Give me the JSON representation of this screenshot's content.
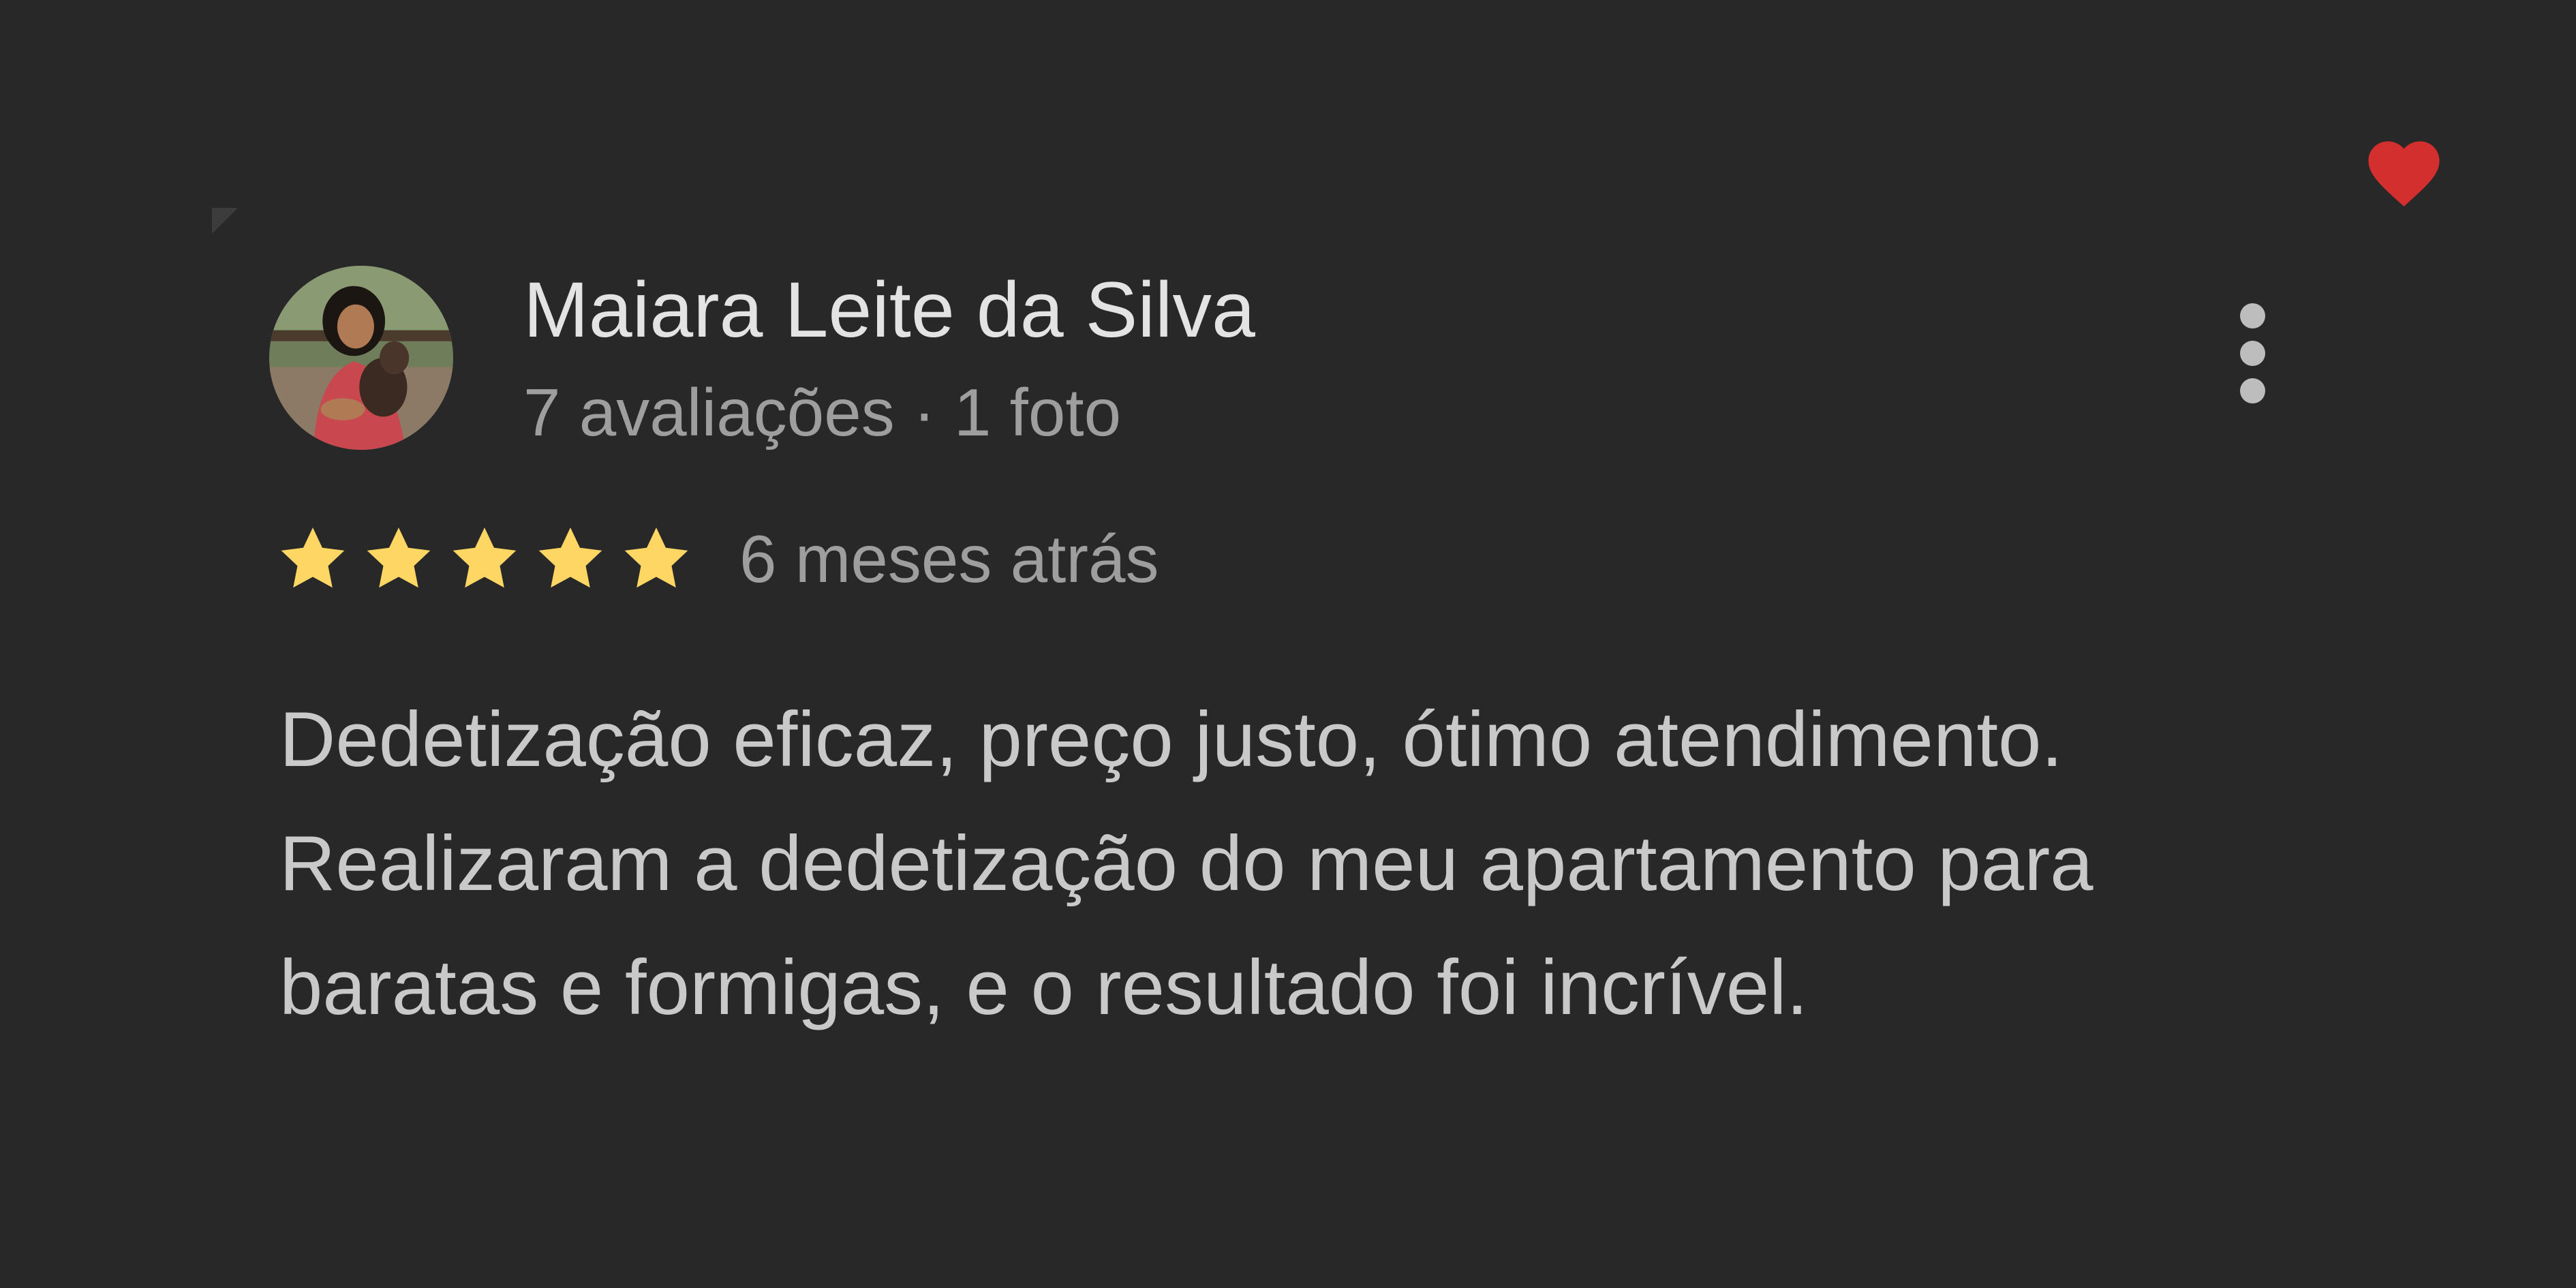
{
  "colors": {
    "background": "#282828",
    "heart": "#d32f2f",
    "star": "#fdd663",
    "name_text": "#e3e3e3",
    "secondary_text": "#9e9e9e",
    "body_text": "#c9c9c9"
  },
  "icons": {
    "favorite": "heart-icon",
    "menu": "more-vertical-icon",
    "rating": "star-icon"
  },
  "review": {
    "author_name": "Maiara Leite da Silva",
    "author_meta": "7 avaliações · 1 foto",
    "rating": 5,
    "rating_max": 5,
    "date": "6 meses atrás",
    "text_lines": [
      "Dedetização eficaz, preço justo, ótimo atendimento.",
      "Realizaram a dedetização do meu apartamento para",
      "baratas e formigas, e o resultado foi incrível."
    ]
  }
}
